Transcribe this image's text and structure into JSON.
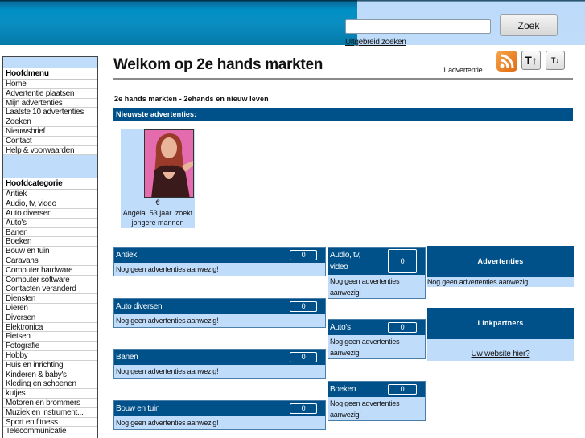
{
  "header": {
    "search_placeholder": "",
    "search_value": "",
    "search_button": "Zoek",
    "advanced_search": "Uitgebreid zoeken"
  },
  "sidebar": {
    "main_menu_title": "Hoofdmenu",
    "main_menu": [
      "Home",
      "Advertentie plaatsen",
      "Mijn advertenties",
      "Laatste 10 advertenties",
      "Zoeken",
      "Nieuwsbrief",
      "Contact",
      "Help & voorwaarden"
    ],
    "categories_title": "Hoofdcategorie",
    "categories": [
      "Antiek",
      "Audio, tv, video",
      "Auto diversen",
      "Auto's",
      "Banen",
      "Boeken",
      "Bouw en tuin",
      "Caravans",
      "Computer hardware",
      "Computer software",
      "Contacten veranderd",
      "Diensten",
      "Dieren",
      "Diversen",
      "Elektronica",
      "Fietsen",
      "Fotografie",
      "Hobby",
      "Huis en inrichting",
      "Kinderen & baby's",
      "Kleding en schoenen",
      "kutjes",
      "Motoren en brommers",
      "Muziek en instrument...",
      "Sport en fitness",
      "Telecommunicatie"
    ]
  },
  "main": {
    "title": "Welkom op 2e hands markten",
    "ad_count": "1 advertentie",
    "icons": {
      "rss": "rss-feed-icon",
      "text_up": "T↑",
      "text_down": "T↓"
    },
    "subtitle": "2e hands markten - 2ehands en nieuw leven",
    "newest_label": "Nieuwste advertenties:",
    "featured": {
      "price": "€",
      "caption": "Angela. 53 jaar. zoekt jongere mannen"
    },
    "empty_text": "Nog geen advertenties aanwezig!",
    "category_boxes": [
      {
        "name": "Antiek",
        "count": "0"
      },
      {
        "name": "Auto diversen",
        "count": "0"
      },
      {
        "name": "Banen",
        "count": "0"
      },
      {
        "name": "Bouw en tuin",
        "count": "0"
      },
      {
        "name": "Audio, tv, video",
        "count": "0"
      },
      {
        "name": "Auto's",
        "count": "0"
      },
      {
        "name": "Boeken",
        "count": "0"
      }
    ],
    "advertenties_box": {
      "title": "Advertenties",
      "text": "Nog geen advertenties aanwezig!"
    },
    "linkpartners_box": {
      "title": "Linkpartners",
      "link": "Uw website hier?"
    }
  },
  "colors": {
    "header_blue": "#0190c4",
    "header_light": "#c0dcfb",
    "box_dark": "#00518a",
    "box_light": "#c0dcfb",
    "rss_orange": "#f08a2a"
  }
}
